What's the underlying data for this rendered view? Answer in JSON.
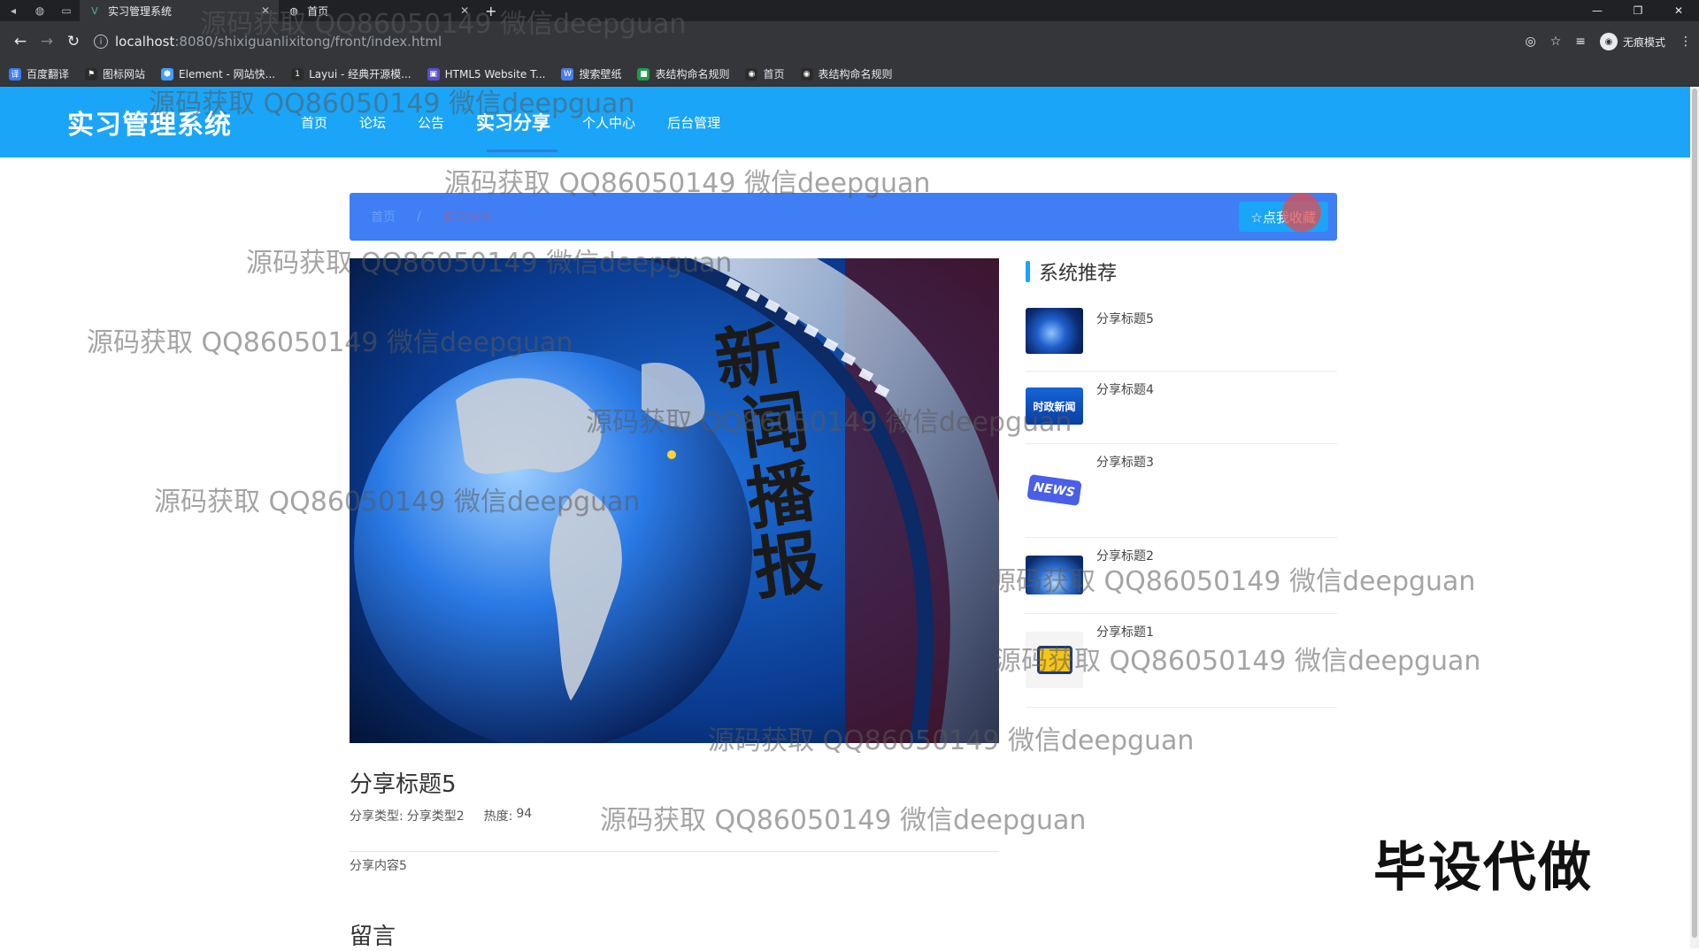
{
  "browser": {
    "tabs": [
      {
        "title": "实习管理系统",
        "active": true
      },
      {
        "title": "首页",
        "active": false
      }
    ],
    "url_host": "localhost",
    "url_path": ":8080/shixiguanlixitong/front/index.html",
    "incognito_label": "无痕模式",
    "bookmarks": [
      {
        "label": "百度翻译",
        "color": "#3a7bf0",
        "glyph": "译"
      },
      {
        "label": "图标网站",
        "color": "#2b2b2b",
        "glyph": "⚑"
      },
      {
        "label": "Element - 网站快...",
        "color": "#409eff",
        "glyph": "⬢"
      },
      {
        "label": "Layui - 经典开源模...",
        "color": "#2b2b2b",
        "glyph": "1"
      },
      {
        "label": "HTML5 Website T...",
        "color": "#5a4fcf",
        "glyph": "▣"
      },
      {
        "label": "搜索壁纸",
        "color": "#4a7de8",
        "glyph": "W"
      },
      {
        "label": "表结构命名规则",
        "color": "#1e9e4a",
        "glyph": "■"
      },
      {
        "label": "首页",
        "color": "#2b2b2b",
        "glyph": "◉"
      },
      {
        "label": "表结构命名规则",
        "color": "#2b2b2b",
        "glyph": "◉"
      }
    ]
  },
  "site": {
    "logo": "实习管理系统",
    "nav": [
      {
        "label": "首页",
        "active": false
      },
      {
        "label": "论坛",
        "active": false
      },
      {
        "label": "公告",
        "active": false
      },
      {
        "label": "实习分享",
        "active": true
      },
      {
        "label": "个人中心",
        "active": false
      },
      {
        "label": "后台管理",
        "active": false
      }
    ]
  },
  "breadcrumb": {
    "home": "首页",
    "sep": "/",
    "current": "实习分享",
    "favorite_button": "☆点我收藏"
  },
  "hero": {
    "overlay_text": [
      "新",
      "闻",
      "播",
      "报"
    ]
  },
  "detail": {
    "title": "分享标题5",
    "type_label": "分享类型:",
    "type_value": "分享类型2",
    "heat_label": "热度:",
    "heat_value": "94",
    "content": "分享内容5"
  },
  "comments": {
    "title": "留言"
  },
  "sidebar": {
    "title": "系统推荐",
    "items": [
      {
        "title": "分享标题5",
        "thumb": "globe"
      },
      {
        "title": "分享标题4",
        "thumb": "politics",
        "thumb_text": "时政新闻"
      },
      {
        "title": "分享标题3",
        "thumb": "news",
        "thumb_text": "NEWS"
      },
      {
        "title": "分享标题2",
        "thumb": "stage"
      },
      {
        "title": "分享标题1",
        "thumb": "tv"
      }
    ]
  },
  "overlays": {
    "watermark": "源码获取 QQ86050149 微信deepguan",
    "corner_stamp": "毕设代做"
  },
  "colors": {
    "header": "#1aa5f8",
    "breadcrumb": "#3f7ef4",
    "accent": "#1aa5f8"
  }
}
